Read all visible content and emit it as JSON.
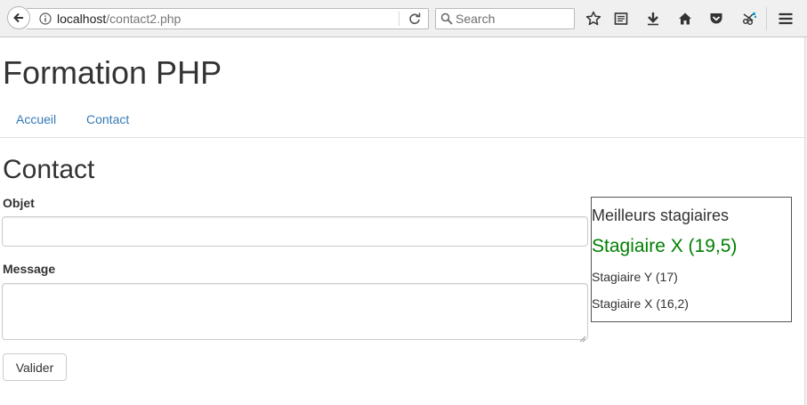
{
  "browser": {
    "url_host": "localhost",
    "url_path": "/contact2.php",
    "search_placeholder": "Search"
  },
  "site": {
    "title": "Formation PHP",
    "nav": [
      {
        "label": "Accueil"
      },
      {
        "label": "Contact"
      }
    ]
  },
  "page": {
    "title": "Contact"
  },
  "form": {
    "subject_label": "Objet",
    "subject_value": "",
    "message_label": "Message",
    "message_value": "",
    "submit_label": "Valider"
  },
  "sidebar": {
    "title": "Meilleurs stagiaires",
    "top": "Stagiaire X (19,5)",
    "items": [
      {
        "label": "Stagiaire Y (17)"
      },
      {
        "label": "Stagiaire X (16,2)"
      }
    ]
  },
  "colors": {
    "link": "#337ab7",
    "highlight": "#008000"
  },
  "icons": [
    "back-arrow-icon",
    "info-icon",
    "reload-icon",
    "search-icon",
    "bookmark-star-icon",
    "reading-list-icon",
    "download-icon",
    "home-icon",
    "pocket-icon",
    "extension-icon",
    "menu-icon"
  ]
}
